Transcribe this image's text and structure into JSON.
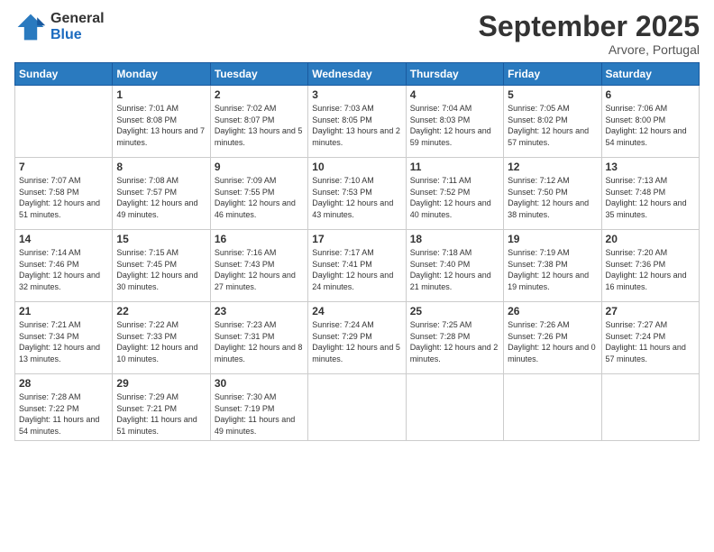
{
  "logo": {
    "general": "General",
    "blue": "Blue"
  },
  "title": "September 2025",
  "location": "Arvore, Portugal",
  "days_of_week": [
    "Sunday",
    "Monday",
    "Tuesday",
    "Wednesday",
    "Thursday",
    "Friday",
    "Saturday"
  ],
  "weeks": [
    [
      {
        "day": "",
        "sunrise": "",
        "sunset": "",
        "daylight": ""
      },
      {
        "day": "1",
        "sunrise": "Sunrise: 7:01 AM",
        "sunset": "Sunset: 8:08 PM",
        "daylight": "Daylight: 13 hours and 7 minutes."
      },
      {
        "day": "2",
        "sunrise": "Sunrise: 7:02 AM",
        "sunset": "Sunset: 8:07 PM",
        "daylight": "Daylight: 13 hours and 5 minutes."
      },
      {
        "day": "3",
        "sunrise": "Sunrise: 7:03 AM",
        "sunset": "Sunset: 8:05 PM",
        "daylight": "Daylight: 13 hours and 2 minutes."
      },
      {
        "day": "4",
        "sunrise": "Sunrise: 7:04 AM",
        "sunset": "Sunset: 8:03 PM",
        "daylight": "Daylight: 12 hours and 59 minutes."
      },
      {
        "day": "5",
        "sunrise": "Sunrise: 7:05 AM",
        "sunset": "Sunset: 8:02 PM",
        "daylight": "Daylight: 12 hours and 57 minutes."
      },
      {
        "day": "6",
        "sunrise": "Sunrise: 7:06 AM",
        "sunset": "Sunset: 8:00 PM",
        "daylight": "Daylight: 12 hours and 54 minutes."
      }
    ],
    [
      {
        "day": "7",
        "sunrise": "Sunrise: 7:07 AM",
        "sunset": "Sunset: 7:58 PM",
        "daylight": "Daylight: 12 hours and 51 minutes."
      },
      {
        "day": "8",
        "sunrise": "Sunrise: 7:08 AM",
        "sunset": "Sunset: 7:57 PM",
        "daylight": "Daylight: 12 hours and 49 minutes."
      },
      {
        "day": "9",
        "sunrise": "Sunrise: 7:09 AM",
        "sunset": "Sunset: 7:55 PM",
        "daylight": "Daylight: 12 hours and 46 minutes."
      },
      {
        "day": "10",
        "sunrise": "Sunrise: 7:10 AM",
        "sunset": "Sunset: 7:53 PM",
        "daylight": "Daylight: 12 hours and 43 minutes."
      },
      {
        "day": "11",
        "sunrise": "Sunrise: 7:11 AM",
        "sunset": "Sunset: 7:52 PM",
        "daylight": "Daylight: 12 hours and 40 minutes."
      },
      {
        "day": "12",
        "sunrise": "Sunrise: 7:12 AM",
        "sunset": "Sunset: 7:50 PM",
        "daylight": "Daylight: 12 hours and 38 minutes."
      },
      {
        "day": "13",
        "sunrise": "Sunrise: 7:13 AM",
        "sunset": "Sunset: 7:48 PM",
        "daylight": "Daylight: 12 hours and 35 minutes."
      }
    ],
    [
      {
        "day": "14",
        "sunrise": "Sunrise: 7:14 AM",
        "sunset": "Sunset: 7:46 PM",
        "daylight": "Daylight: 12 hours and 32 minutes."
      },
      {
        "day": "15",
        "sunrise": "Sunrise: 7:15 AM",
        "sunset": "Sunset: 7:45 PM",
        "daylight": "Daylight: 12 hours and 30 minutes."
      },
      {
        "day": "16",
        "sunrise": "Sunrise: 7:16 AM",
        "sunset": "Sunset: 7:43 PM",
        "daylight": "Daylight: 12 hours and 27 minutes."
      },
      {
        "day": "17",
        "sunrise": "Sunrise: 7:17 AM",
        "sunset": "Sunset: 7:41 PM",
        "daylight": "Daylight: 12 hours and 24 minutes."
      },
      {
        "day": "18",
        "sunrise": "Sunrise: 7:18 AM",
        "sunset": "Sunset: 7:40 PM",
        "daylight": "Daylight: 12 hours and 21 minutes."
      },
      {
        "day": "19",
        "sunrise": "Sunrise: 7:19 AM",
        "sunset": "Sunset: 7:38 PM",
        "daylight": "Daylight: 12 hours and 19 minutes."
      },
      {
        "day": "20",
        "sunrise": "Sunrise: 7:20 AM",
        "sunset": "Sunset: 7:36 PM",
        "daylight": "Daylight: 12 hours and 16 minutes."
      }
    ],
    [
      {
        "day": "21",
        "sunrise": "Sunrise: 7:21 AM",
        "sunset": "Sunset: 7:34 PM",
        "daylight": "Daylight: 12 hours and 13 minutes."
      },
      {
        "day": "22",
        "sunrise": "Sunrise: 7:22 AM",
        "sunset": "Sunset: 7:33 PM",
        "daylight": "Daylight: 12 hours and 10 minutes."
      },
      {
        "day": "23",
        "sunrise": "Sunrise: 7:23 AM",
        "sunset": "Sunset: 7:31 PM",
        "daylight": "Daylight: 12 hours and 8 minutes."
      },
      {
        "day": "24",
        "sunrise": "Sunrise: 7:24 AM",
        "sunset": "Sunset: 7:29 PM",
        "daylight": "Daylight: 12 hours and 5 minutes."
      },
      {
        "day": "25",
        "sunrise": "Sunrise: 7:25 AM",
        "sunset": "Sunset: 7:28 PM",
        "daylight": "Daylight: 12 hours and 2 minutes."
      },
      {
        "day": "26",
        "sunrise": "Sunrise: 7:26 AM",
        "sunset": "Sunset: 7:26 PM",
        "daylight": "Daylight: 12 hours and 0 minutes."
      },
      {
        "day": "27",
        "sunrise": "Sunrise: 7:27 AM",
        "sunset": "Sunset: 7:24 PM",
        "daylight": "Daylight: 11 hours and 57 minutes."
      }
    ],
    [
      {
        "day": "28",
        "sunrise": "Sunrise: 7:28 AM",
        "sunset": "Sunset: 7:22 PM",
        "daylight": "Daylight: 11 hours and 54 minutes."
      },
      {
        "day": "29",
        "sunrise": "Sunrise: 7:29 AM",
        "sunset": "Sunset: 7:21 PM",
        "daylight": "Daylight: 11 hours and 51 minutes."
      },
      {
        "day": "30",
        "sunrise": "Sunrise: 7:30 AM",
        "sunset": "Sunset: 7:19 PM",
        "daylight": "Daylight: 11 hours and 49 minutes."
      },
      {
        "day": "",
        "sunrise": "",
        "sunset": "",
        "daylight": ""
      },
      {
        "day": "",
        "sunrise": "",
        "sunset": "",
        "daylight": ""
      },
      {
        "day": "",
        "sunrise": "",
        "sunset": "",
        "daylight": ""
      },
      {
        "day": "",
        "sunrise": "",
        "sunset": "",
        "daylight": ""
      }
    ]
  ]
}
